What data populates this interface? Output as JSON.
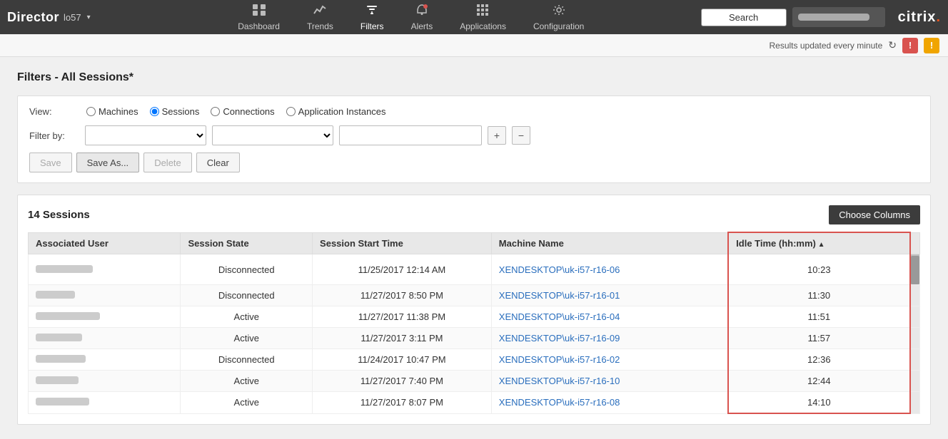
{
  "brand": {
    "name": "Director",
    "site": "lo57",
    "citrix": "citrix."
  },
  "nav": {
    "items": [
      {
        "id": "dashboard",
        "label": "Dashboard",
        "icon": "⊞"
      },
      {
        "id": "trends",
        "label": "Trends",
        "icon": "📊"
      },
      {
        "id": "filters",
        "label": "Filters",
        "icon": "⊡"
      },
      {
        "id": "alerts",
        "label": "Alerts",
        "icon": "🔔"
      },
      {
        "id": "applications",
        "label": "Applications",
        "icon": "⊞"
      },
      {
        "id": "configuration",
        "label": "Configuration",
        "icon": "⚙"
      }
    ]
  },
  "statusbar": {
    "text": "Results updated every minute",
    "refresh_icon": "↻",
    "alert_icon": "!",
    "warn_icon": "!"
  },
  "search": {
    "label": "Search",
    "placeholder": "Search"
  },
  "page": {
    "title": "Filters - All Sessions*"
  },
  "filters": {
    "view_label": "View:",
    "view_options": [
      {
        "id": "machines",
        "label": "Machines"
      },
      {
        "id": "sessions",
        "label": "Sessions",
        "checked": true
      },
      {
        "id": "connections",
        "label": "Connections"
      },
      {
        "id": "appinstances",
        "label": "Application Instances"
      }
    ],
    "filterby_label": "Filter by:",
    "buttons": {
      "save": "Save",
      "save_as": "Save As...",
      "delete": "Delete",
      "clear": "Clear"
    }
  },
  "table": {
    "title": "14 Sessions",
    "choose_columns": "Choose Columns",
    "columns": [
      {
        "id": "user",
        "label": "Associated User"
      },
      {
        "id": "state",
        "label": "Session State"
      },
      {
        "id": "start",
        "label": "Session Start Time"
      },
      {
        "id": "machine",
        "label": "Machine Name"
      },
      {
        "id": "idle",
        "label": "Idle Time (hh:mm)",
        "sorted": "asc"
      }
    ],
    "rows": [
      {
        "state": "Disconnected",
        "start": "11/25/2017 12:14 AM",
        "machine": "XENDESKTOP\\uk-i57-r16-06",
        "idle": "10:23"
      },
      {
        "state": "Disconnected",
        "start": "11/27/2017 8:50 PM",
        "machine": "XENDESKTOP\\uk-i57-r16-01",
        "idle": "11:30"
      },
      {
        "state": "Active",
        "start": "11/27/2017 11:38 PM",
        "machine": "XENDESKTOP\\uk-i57-r16-04",
        "idle": "11:51"
      },
      {
        "state": "Active",
        "start": "11/27/2017 3:11 PM",
        "machine": "XENDESKTOP\\uk-i57-r16-09",
        "idle": "11:57"
      },
      {
        "state": "Disconnected",
        "start": "11/24/2017 10:47 PM",
        "machine": "XENDESKTOP\\uk-i57-r16-02",
        "idle": "12:36"
      },
      {
        "state": "Active",
        "start": "11/27/2017 7:40 PM",
        "machine": "XENDESKTOP\\uk-i57-r16-10",
        "idle": "12:44"
      },
      {
        "state": "Active",
        "start": "11/27/2017 8:07 PM",
        "machine": "XENDESKTOP\\uk-i57-r16-08",
        "idle": "14:10"
      }
    ],
    "user_blur_widths": [
      80,
      55,
      90,
      65,
      70,
      60,
      75
    ]
  }
}
